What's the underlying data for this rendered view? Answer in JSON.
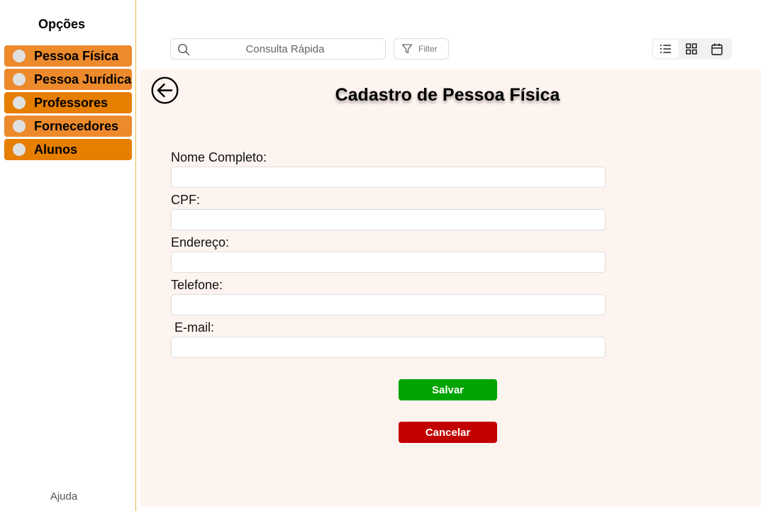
{
  "sidebar": {
    "title": "Opções",
    "items": [
      {
        "label": "Pessoa Física",
        "color": "#ed8a2c"
      },
      {
        "label": "Pessoa Jurídica",
        "color": "#ed8a2c"
      },
      {
        "label": "Professores",
        "color": "#e67e00"
      },
      {
        "label": "Fornecedores",
        "color": "#ed8a2c"
      },
      {
        "label": "Alunos",
        "color": "#e67e00"
      }
    ],
    "help": "Ajuda"
  },
  "toolbar": {
    "search_placeholder": "Consulta Rápida",
    "search_icon": "search-icon",
    "filter_label": "Filter",
    "filter_icon": "filter-icon",
    "views": [
      {
        "icon": "list-icon",
        "active": true
      },
      {
        "icon": "grid-icon",
        "active": false
      },
      {
        "icon": "calendar-icon",
        "active": false
      }
    ]
  },
  "form": {
    "title": "Cadastro de Pessoa Física",
    "back_icon": "arrow-left-circle-icon",
    "fields": [
      {
        "label": "Nome Completo:",
        "value": ""
      },
      {
        "label": "CPF:",
        "value": ""
      },
      {
        "label": "Endereço:",
        "value": ""
      },
      {
        "label": "Telefone:",
        "value": ""
      },
      {
        "label": " E-mail:",
        "value": ""
      }
    ],
    "save_label": "Salvar",
    "save_color": "#00a400",
    "cancel_label": "Cancelar",
    "cancel_color": "#c30000"
  },
  "colors": {
    "panel_background": "#fdf3ef",
    "sidebar_border": "#e9b34a"
  }
}
